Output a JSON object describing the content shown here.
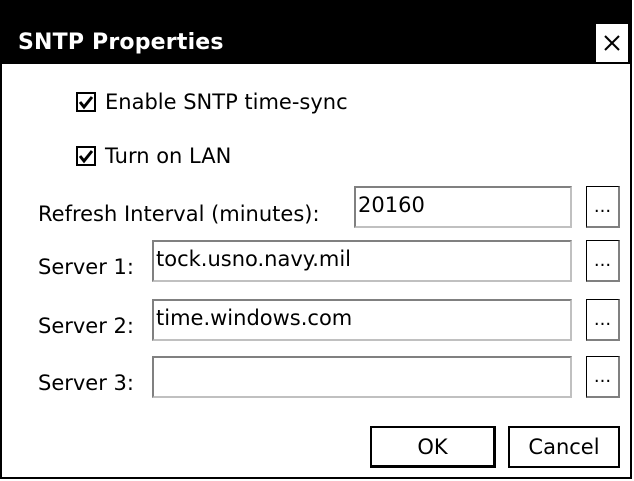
{
  "dialog": {
    "title": "SNTP Properties",
    "close_icon": "close-x-icon"
  },
  "options": {
    "enable_sntp": {
      "label": "Enable SNTP time-sync",
      "checked": true
    },
    "turn_on_lan": {
      "label": "Turn on LAN",
      "checked": true
    }
  },
  "fields": {
    "refresh": {
      "label": "Refresh Interval (minutes):",
      "value": "20160",
      "browse_label": "..."
    },
    "server1": {
      "label": "Server 1:",
      "value": "tock.usno.navy.mil",
      "browse_label": "..."
    },
    "server2": {
      "label": "Server 2:",
      "value": "time.windows.com",
      "browse_label": "..."
    },
    "server3": {
      "label": "Server 3:",
      "value": "",
      "browse_label": "..."
    }
  },
  "buttons": {
    "ok": "OK",
    "cancel": "Cancel"
  }
}
